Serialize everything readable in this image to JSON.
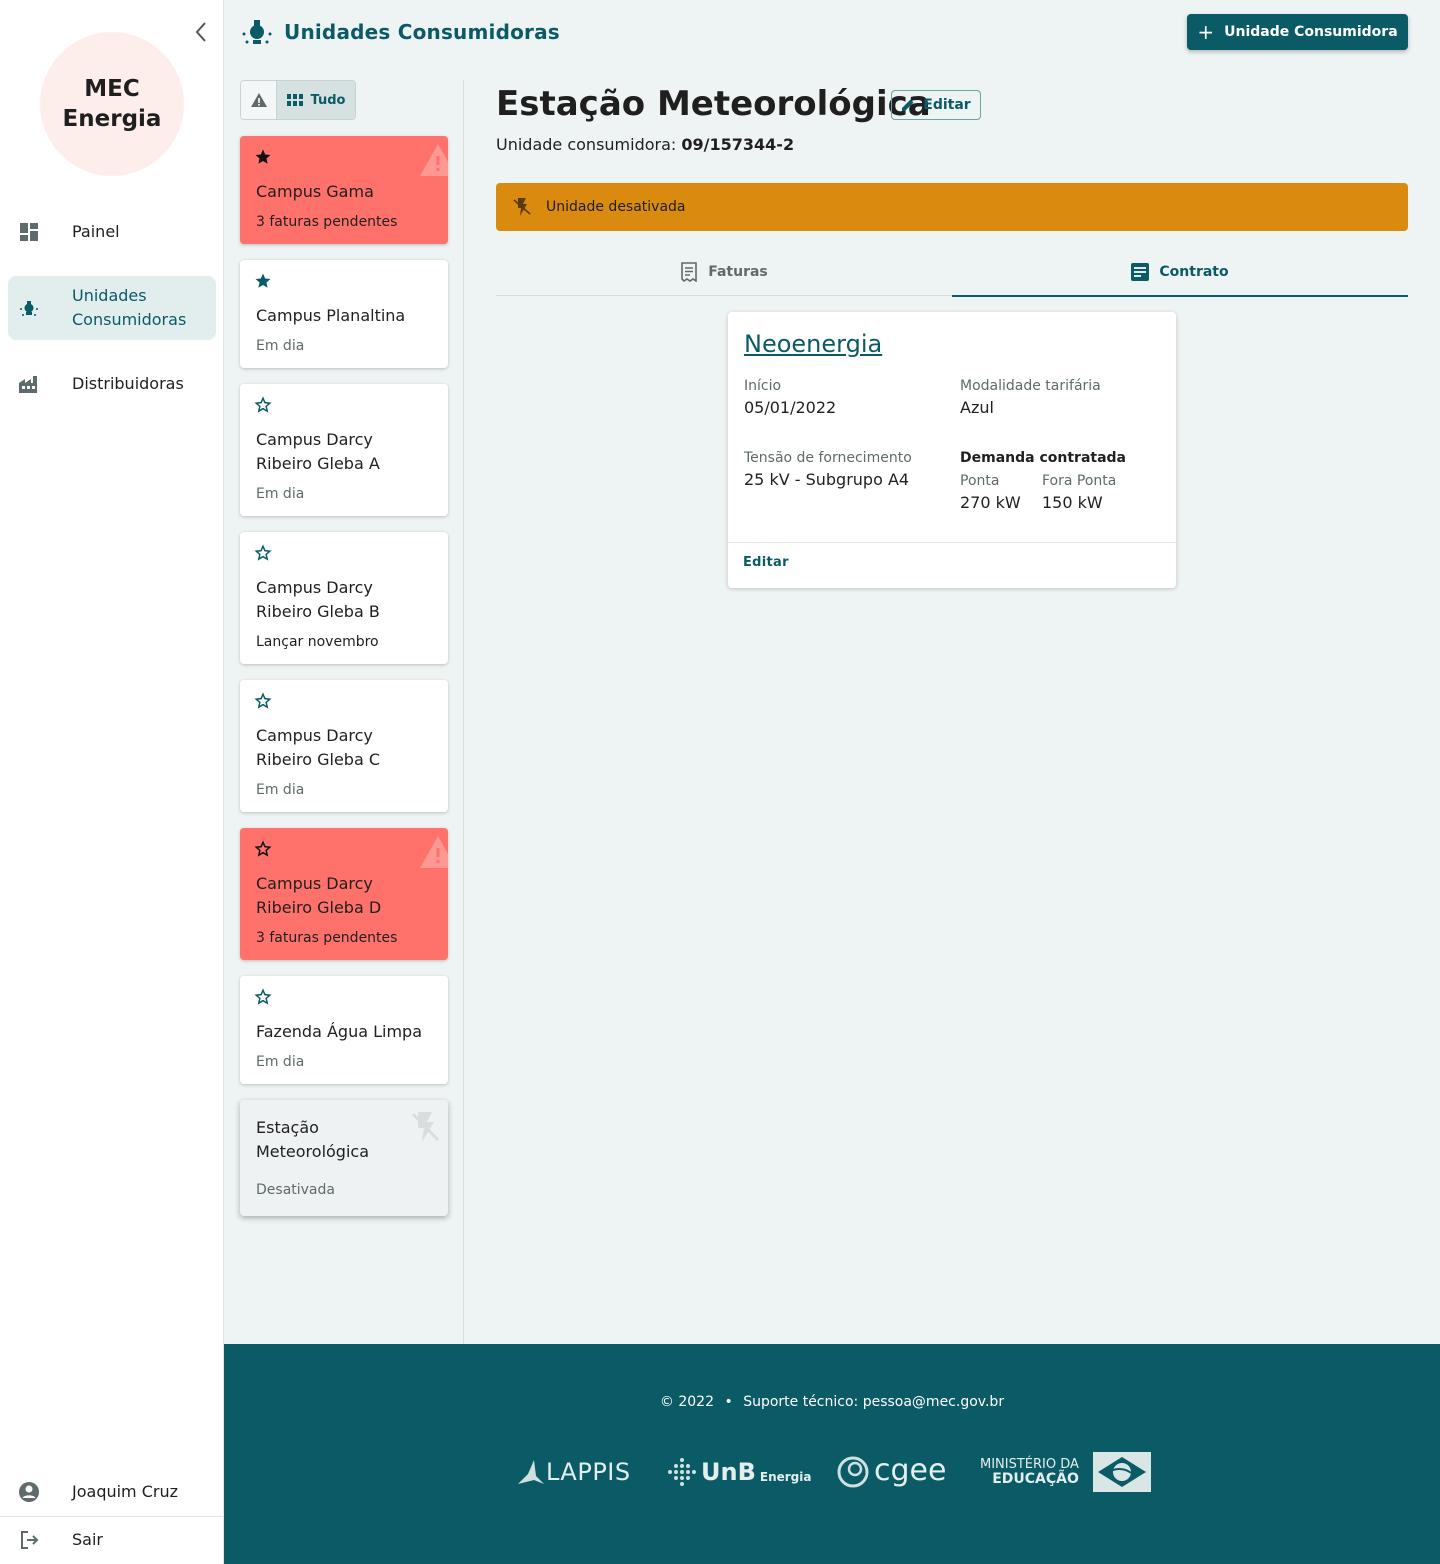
{
  "app": {
    "logo_line1": "MEC",
    "logo_line2": "Energia",
    "collapse_icon": "chevron-left-icon"
  },
  "sidebar": {
    "items": [
      {
        "label": "Painel",
        "icon": "dashboard-icon",
        "active": false
      },
      {
        "label": "Unidades Consumidoras",
        "icon": "lightbulb-icon",
        "active": true
      },
      {
        "label": "Distribuidoras",
        "icon": "factory-icon",
        "active": false
      }
    ],
    "user_name": "Joaquim Cruz",
    "logout_label": "Sair"
  },
  "header": {
    "title": "Unidades Consumidoras",
    "add_button_label": "Unidade Consumidora"
  },
  "filter": {
    "all_label": "Tudo",
    "selected": "Tudo"
  },
  "units": [
    {
      "name": "Campus Gama",
      "status": "3 faturas pendentes",
      "favorite": true,
      "state": "alert"
    },
    {
      "name": "Campus Planaltina",
      "status": "Em dia",
      "favorite": true,
      "state": "ok"
    },
    {
      "name": "Campus Darcy Ribeiro Gleba A",
      "status": "Em dia",
      "favorite": false,
      "state": "ok"
    },
    {
      "name": "Campus Darcy Ribeiro Gleba B",
      "status": "Lançar novembro",
      "favorite": false,
      "state": "ok"
    },
    {
      "name": "Campus Darcy Ribeiro Gleba C",
      "status": "Em dia",
      "favorite": false,
      "state": "ok"
    },
    {
      "name": "Campus Darcy Ribeiro Gleba D",
      "status": "3 faturas pendentes",
      "favorite": false,
      "state": "alert"
    },
    {
      "name": "Fazenda Água Limpa",
      "status": "Em dia",
      "favorite": false,
      "state": "ok"
    },
    {
      "name": "Estação Meteorológica",
      "status": "Desativada",
      "favorite": false,
      "state": "disabled"
    }
  ],
  "detail": {
    "title": "Estação Meteorológica",
    "edit_label": "Editar",
    "uc_label": "Unidade consumidora:",
    "uc_number": "09/157344-2",
    "banner_text": "Unidade desativada",
    "tabs": [
      {
        "label": "Faturas",
        "icon": "receipt-icon",
        "active": false
      },
      {
        "label": "Contrato",
        "icon": "contract-icon",
        "active": true
      }
    ],
    "contract": {
      "distributor": "Neoenergia",
      "start_label": "Início",
      "start_value": "05/01/2022",
      "tariff_label": "Modalidade tarifária",
      "tariff_value": "Azul",
      "voltage_label": "Tensão de fornecimento",
      "voltage_value": "25 kV - Subgrupo A4",
      "demand_label": "Demanda contratada",
      "peak_label": "Ponta",
      "peak_value": "270 kW",
      "offpeak_label": "Fora Ponta",
      "offpeak_value": "150 kW",
      "edit_label": "Editar"
    }
  },
  "footer": {
    "copyright": "© 2022",
    "separator": "•",
    "support_text": "Suporte técnico: pessoa@mec.gov.br",
    "logos": {
      "lappis": "LAPPIS",
      "unb": "UnB",
      "unb_sub": "Energia",
      "cgee": "cgee",
      "mec_line1": "MINISTÉRIO DA",
      "mec_line2": "EDUCAÇÃO"
    }
  },
  "colors": {
    "primary": "#0b5b66",
    "alert_card": "#ff726c",
    "banner": "#da8a0e",
    "logo_bg": "#fdeeec"
  }
}
